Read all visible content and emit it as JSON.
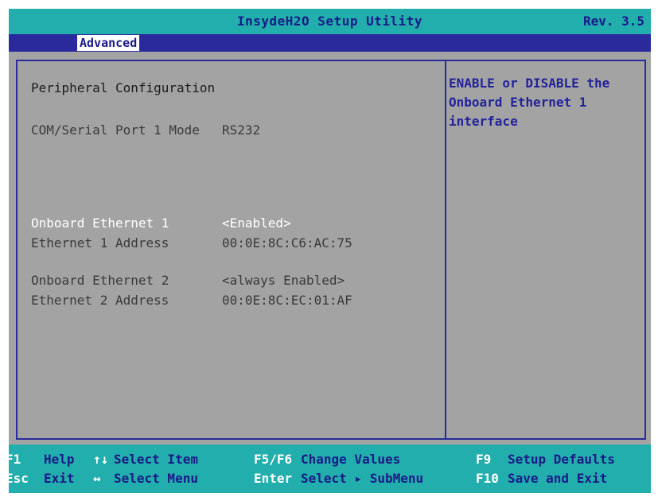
{
  "title": {
    "app_name": "InsydeH2O Setup Utility",
    "revision": "Rev. 3.5"
  },
  "tabs": [
    {
      "label": "Advanced",
      "active": true
    }
  ],
  "section": {
    "heading": "Peripheral Configuration"
  },
  "settings": {
    "com_port": {
      "label": "COM/Serial Port 1 Mode",
      "value": "RS232"
    },
    "eth1": {
      "label": "Onboard Ethernet 1",
      "value": "<Enabled>",
      "selected": true
    },
    "eth1_addr": {
      "label": "Ethernet 1 Address",
      "value": "00:0E:8C:C6:AC:75"
    },
    "eth2": {
      "label": "Onboard Ethernet 2",
      "value": "<always Enabled>"
    },
    "eth2_addr": {
      "label": "Ethernet 2 Address",
      "value": "00:0E:8C:EC:01:AF"
    }
  },
  "help_text": {
    "lines": [
      "ENABLE or DISABLE the",
      "Onboard Ethernet 1",
      "interface"
    ]
  },
  "footer": {
    "row1": [
      {
        "key": "F1",
        "label": "Help"
      },
      {
        "key": "↑↓",
        "label": "Select Item"
      },
      {
        "key": "F5/F6",
        "label": "Change Values"
      },
      {
        "key": "F9",
        "label": "Setup Defaults"
      }
    ],
    "row2": [
      {
        "key": "Esc",
        "label": "Exit"
      },
      {
        "key": "↔",
        "label": "Select Menu"
      },
      {
        "key": "Enter",
        "label": "Select ▸ SubMenu"
      },
      {
        "key": "F10",
        "label": "Save and Exit"
      }
    ]
  },
  "colors": {
    "teal": "#22aeac",
    "navy": "#2a2a9c",
    "panel_gray": "#a3a3a3",
    "selected_text": "#ffffff",
    "help_text": "#22229a"
  }
}
